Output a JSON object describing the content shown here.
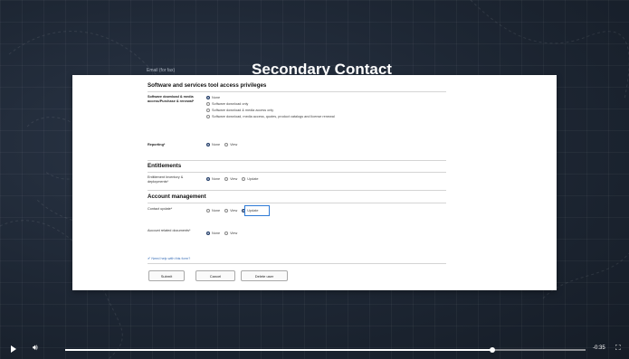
{
  "page": {
    "heading": "Secondary Contact",
    "faint_label": "Email (for fax)"
  },
  "form": {
    "sections": {
      "software": "Software and services tool access privileges",
      "entitlements": "Entitlements",
      "account": "Account management"
    },
    "fields": {
      "software_download": {
        "label": "Software download & media access/Purchase & renewal*",
        "options": [
          "None",
          "Software download only",
          "Software download & media access only",
          "Software download, media access, quotes, product catalogs and license renewal"
        ],
        "selected_index": 0
      },
      "reporting": {
        "label": "Reporting*",
        "options": [
          "None",
          "View"
        ],
        "selected_index": 0
      },
      "entitlement_inventory": {
        "label": "Entitlement Inventory & deployments*",
        "options": [
          "None",
          "View",
          "Update"
        ],
        "selected_index": 0
      },
      "contact_update": {
        "label": "Contact update*",
        "options": [
          "None",
          "View",
          "Update"
        ],
        "selected_index": 2
      },
      "account_related": {
        "label": "Account related documents*",
        "options": [
          "None",
          "View"
        ],
        "selected_index": 0
      }
    },
    "help_link": "Need help with this form?",
    "buttons": {
      "submit": "Submit",
      "cancel": "Cancel",
      "delete": "Delete user"
    }
  },
  "player": {
    "time": "-0:35",
    "progress_fraction": 0.82
  }
}
